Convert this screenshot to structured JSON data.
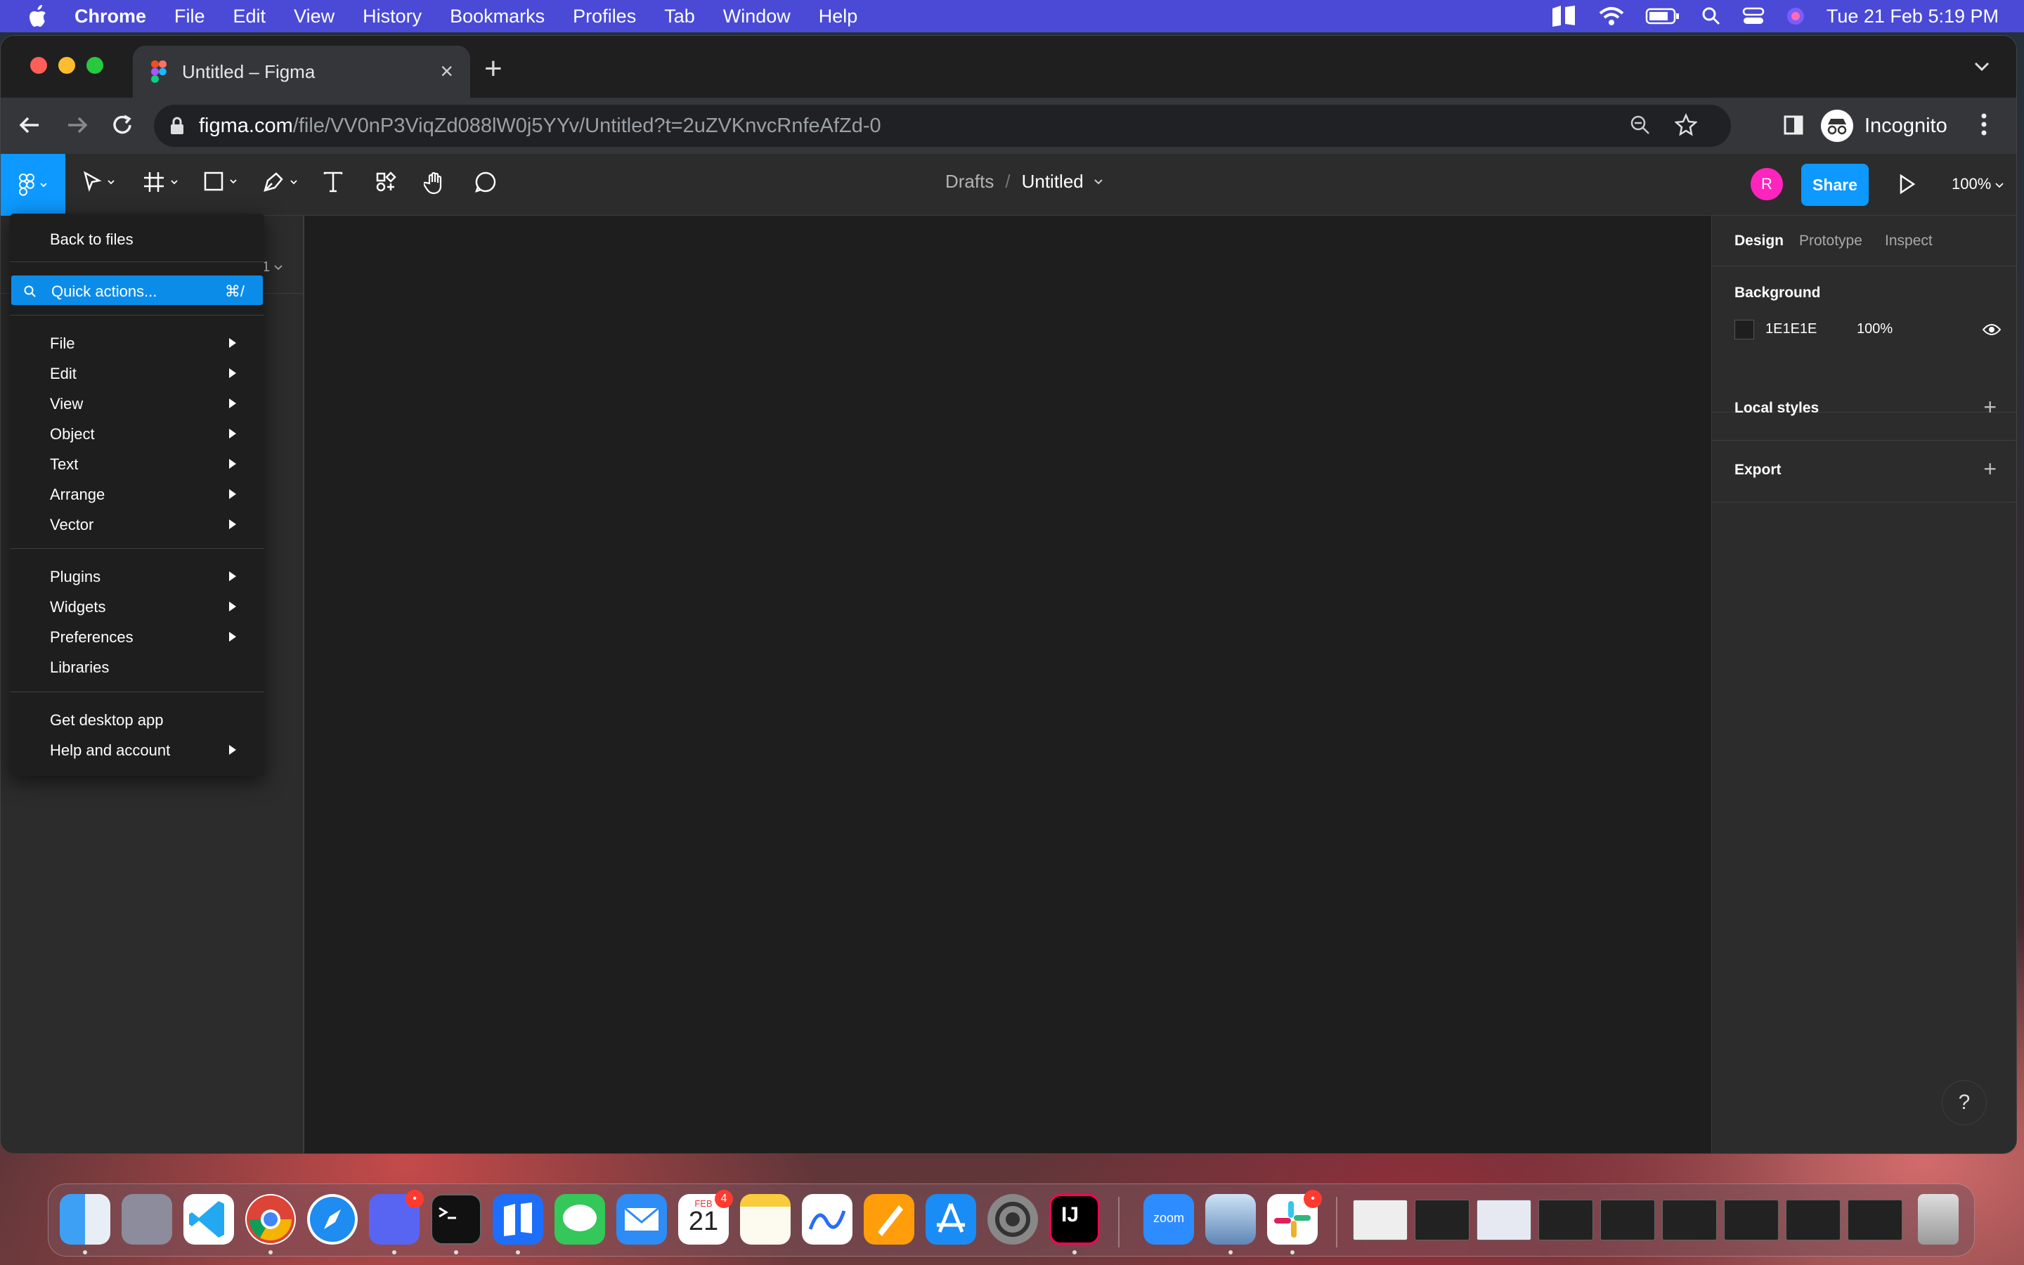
{
  "menubar": {
    "app": "Chrome",
    "items": [
      "File",
      "Edit",
      "View",
      "History",
      "Bookmarks",
      "Profiles",
      "Tab",
      "Window",
      "Help"
    ],
    "clock": "Tue 21 Feb  5:19 PM"
  },
  "browser": {
    "tab_title": "Untitled – Figma",
    "url_domain": "figma.com",
    "url_path": "/file/VV0nP3ViqZd088lW0j5YYv/Untitled?t=2uZVKnvcRnfeAfZd-0",
    "profile_label": "Incognito"
  },
  "figma": {
    "breadcrumb_drafts": "Drafts",
    "breadcrumb_sep": "/",
    "file_name": "Untitled",
    "avatar_initial": "R",
    "share_label": "Share",
    "zoom_label": "100%",
    "page_selector": "1",
    "right_panel": {
      "tabs": [
        "Design",
        "Prototype",
        "Inspect"
      ],
      "background_title": "Background",
      "bg_hex": "1E1E1E",
      "bg_opacity": "100%",
      "local_styles": "Local styles",
      "export": "Export"
    },
    "help_label": "?"
  },
  "main_menu": {
    "back_to_files": "Back to files",
    "quick_actions": "Quick actions...",
    "quick_actions_shortcut": "⌘/",
    "items_group1": [
      "File",
      "Edit",
      "View",
      "Object",
      "Text",
      "Arrange",
      "Vector"
    ],
    "items_group2": [
      "Plugins",
      "Widgets",
      "Preferences",
      "Libraries"
    ],
    "items_group3": [
      "Get desktop app",
      "Help and account"
    ]
  },
  "dock": {
    "calendar_month": "FEB",
    "calendar_day": "21",
    "calendar_badge": "4",
    "zoom_label": "zoom",
    "intellij_label": "IJ"
  },
  "colors": {
    "figma_blue": "#0d99ff",
    "menubar": "#4a4ad6",
    "highlight": "#0c8ce9"
  }
}
